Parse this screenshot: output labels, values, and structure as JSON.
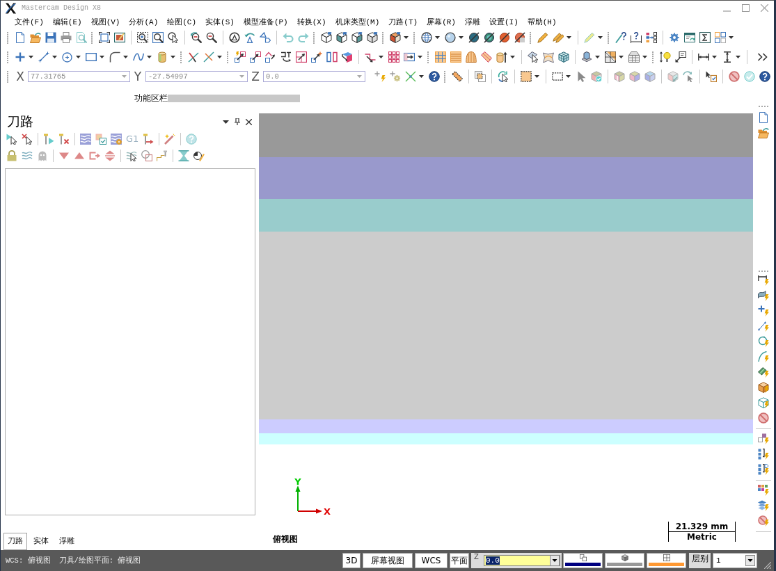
{
  "window": {
    "title": "Mastercam Design X8"
  },
  "menu": [
    {
      "label": "文件(F)"
    },
    {
      "label": "编辑(E)"
    },
    {
      "label": "视图(V)"
    },
    {
      "label": "分析(A)"
    },
    {
      "label": "绘图(C)"
    },
    {
      "label": "实体(S)"
    },
    {
      "label": "模型准备(P)"
    },
    {
      "label": "转换(X)"
    },
    {
      "label": "机床类型(M)"
    },
    {
      "label": "刀路(T)"
    },
    {
      "label": "屏幕(R)"
    },
    {
      "label": "浮雕"
    },
    {
      "label": "设置(I)"
    },
    {
      "label": "帮助(H)"
    }
  ],
  "coordinates": [
    {
      "axis": "X",
      "value": "77.31765",
      "disabled": true
    },
    {
      "axis": "Y",
      "value": "-27.54997",
      "disabled": true
    },
    {
      "axis": "Z",
      "value": "0.0",
      "disabled": true
    }
  ],
  "ribbon": {
    "label": "功能区栏"
  },
  "toolpath_panel": {
    "title": "刀路",
    "g_code_button": "G1",
    "tabs": [
      {
        "label": "刀路",
        "selected": true
      },
      {
        "label": "实体",
        "selected": false
      },
      {
        "label": "浮雕",
        "selected": false
      }
    ]
  },
  "viewport": {
    "bands": [
      {
        "color": "#999999"
      },
      {
        "color": "#9999cc"
      },
      {
        "color": "#99cccc"
      },
      {
        "color": "#cccccc"
      },
      {
        "color": "#ccccff"
      },
      {
        "color": "#ccffff"
      }
    ],
    "axis_labels": {
      "y": "Y",
      "x": "X"
    },
    "view_name": "俯视图",
    "scale": {
      "length": "21.329 mm",
      "units": "Metric"
    }
  },
  "status_bar": {
    "wcs": "WCS: 俯视图",
    "tool_plane": "刀具/绘图平面: 俯视图",
    "buttons": [
      {
        "label": "3D"
      },
      {
        "label": "屏幕视图"
      },
      {
        "label": "WCS"
      },
      {
        "label": "平面"
      }
    ],
    "z_field": {
      "label": "Z",
      "value": "0.0",
      "text_selected": true
    },
    "attribute_buttons": [
      {
        "color": "#000080"
      },
      {
        "color": "#999999"
      },
      {
        "color": "#ff9933"
      }
    ],
    "level_label": "层别",
    "level_field": {
      "value": "1"
    }
  }
}
